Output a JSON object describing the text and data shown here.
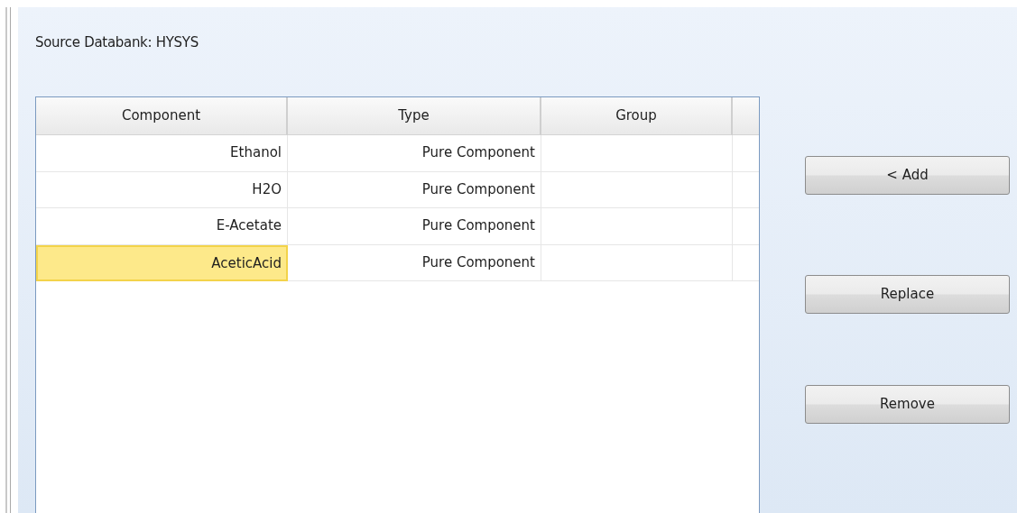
{
  "source_label": "Source Databank: HYSYS",
  "table": {
    "columns": [
      "Component",
      "Type",
      "Group"
    ],
    "rows": [
      {
        "component": "Ethanol",
        "type": "Pure Component",
        "selected": false
      },
      {
        "component": "H2O",
        "type": "Pure Component",
        "selected": false
      },
      {
        "component": "E-Acetate",
        "type": "Pure Component",
        "selected": false
      },
      {
        "component": "AceticAcid",
        "type": "Pure Component",
        "selected": true
      }
    ]
  },
  "buttons": [
    "< Add",
    "Replace",
    "Remove"
  ]
}
